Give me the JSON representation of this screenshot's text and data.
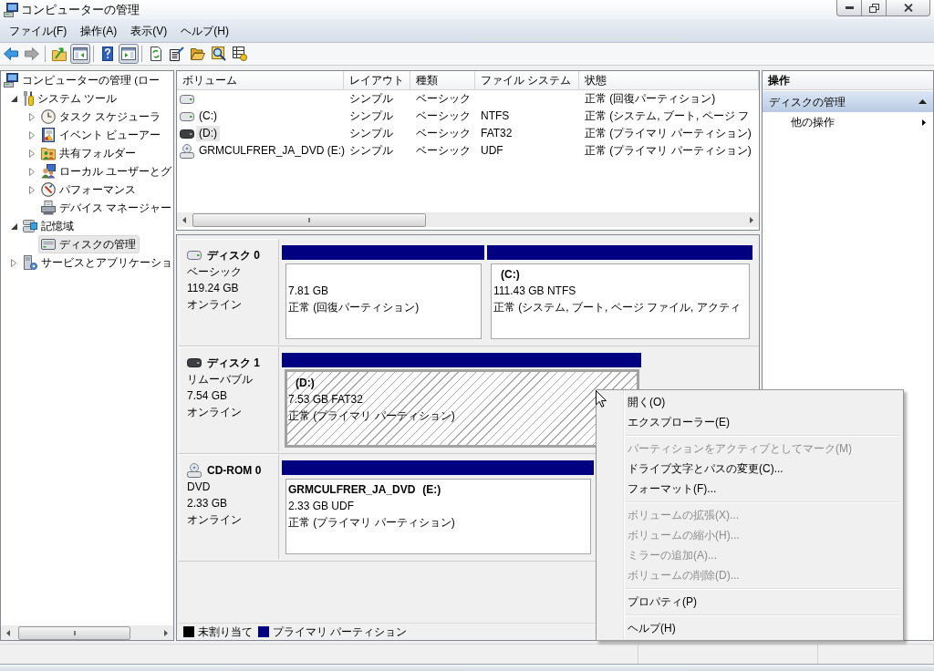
{
  "window": {
    "title": "コンピューターの管理"
  },
  "menu_bar": [
    "ファイル(F)",
    "操作(A)",
    "表示(V)",
    "ヘルプ(H)"
  ],
  "toolbar": {
    "groups": [
      {
        "buttons": [
          {
            "kind": "back",
            "disabled": false,
            "pressed": false
          },
          {
            "kind": "forward",
            "disabled": true,
            "pressed": false
          }
        ]
      },
      {
        "buttons": [
          {
            "kind": "up",
            "disabled": false,
            "pressed": false
          },
          {
            "kind": "tree-toggle",
            "disabled": false,
            "pressed": true
          }
        ]
      },
      {
        "buttons": [
          {
            "kind": "help",
            "disabled": false,
            "pressed": false
          },
          {
            "kind": "action-toggle",
            "disabled": false,
            "pressed": true
          }
        ]
      },
      {
        "buttons": [
          {
            "kind": "refresh",
            "disabled": false,
            "pressed": false
          },
          {
            "kind": "properties",
            "disabled": false,
            "pressed": false
          },
          {
            "kind": "open",
            "disabled": false,
            "pressed": false
          },
          {
            "kind": "search",
            "disabled": false,
            "pressed": false
          },
          {
            "kind": "settings",
            "disabled": false,
            "pressed": false
          }
        ]
      }
    ]
  },
  "tree": {
    "items": [
      {
        "kind": "computer",
        "label": "コンピューターの管理 (ロー",
        "selected": false,
        "children": [
          {
            "kind": "tools",
            "label": "システム ツール",
            "expanded": true,
            "selected": false,
            "children": [
              {
                "kind": "clock",
                "label": "タスク スケジューラ",
                "expanded": false,
                "selected": false
              },
              {
                "kind": "event-log",
                "label": "イベント ビューアー",
                "expanded": false,
                "selected": false
              },
              {
                "kind": "shared-folder",
                "label": "共有フォルダー",
                "expanded": false,
                "selected": false
              },
              {
                "kind": "users",
                "label": "ローカル ユーザーとグ",
                "expanded": false,
                "selected": false
              },
              {
                "kind": "performance",
                "label": "パフォーマンス",
                "expanded": false,
                "selected": false
              },
              {
                "kind": "device",
                "label": "デバイス マネージャー",
                "selected": false
              }
            ]
          },
          {
            "kind": "storage",
            "label": "記憶域",
            "expanded": true,
            "selected": false,
            "children": [
              {
                "kind": "disk",
                "label": "ディスクの管理",
                "selected": true
              }
            ]
          },
          {
            "kind": "services",
            "label": "サービスとアプリケーショ",
            "expanded": false,
            "selected": false
          }
        ]
      }
    ]
  },
  "volume_list": {
    "columns": [
      "ボリューム",
      "レイアウト",
      "種類",
      "ファイル システム",
      "状態"
    ],
    "rows": [
      {
        "kind": "hdd",
        "selected": false,
        "layout": "シンプル",
        "type": "ベーシック",
        "status": "正常 (回復パーティション)"
      },
      {
        "kind": "hdd",
        "selected": false,
        "volume": "(C:)",
        "layout": "シンプル",
        "type": "ベーシック",
        "file_system": "NTFS",
        "status": "正常 (システム, ブート, ページ フ"
      },
      {
        "kind": "removable",
        "selected": true,
        "volume": "(D:)",
        "layout": "シンプル",
        "type": "ベーシック",
        "file_system": "FAT32",
        "status": "正常 (プライマリ パーティション)"
      },
      {
        "kind": "cdrom",
        "selected": false,
        "volume": "GRMCULFRER_JA_DVD (E:)",
        "layout": "シンプル",
        "type": "ベーシック",
        "file_system": "UDF",
        "status": "正常 (プライマリ パーティション)"
      }
    ]
  },
  "disks": [
    {
      "kind": "hdd",
      "name": "ディスク 0",
      "type": "ベーシック",
      "size": "119.24 GB",
      "state": "オンライン",
      "partitions": [
        {
          "selected": false,
          "size": "7.81 GB",
          "status": "正常 (回復パーティション)"
        },
        {
          "selected": false,
          "letter": "(C:)",
          "size": "111.43 GB NTFS",
          "status": "正常 (システム, ブート, ページ ファイル, アクティ"
        }
      ]
    },
    {
      "kind": "removable",
      "name": "ディスク 1",
      "type": "リムーバブル",
      "size": "7.54 GB",
      "state": "オンライン",
      "partitions": [
        {
          "selected": true,
          "letter": "(D:)",
          "size": "7.53 GB FAT32",
          "status": "正常 (プライマリ パーティション)"
        }
      ]
    },
    {
      "kind": "cdrom",
      "name": "CD-ROM 0",
      "type": "DVD",
      "size": "2.33 GB",
      "state": "オンライン",
      "partitions": [
        {
          "selected": false,
          "label": "GRMCULFRER_JA_DVD",
          "letter": "(E:)",
          "size": "2.33 GB UDF",
          "status": "正常 (プライマリ パーティション)"
        }
      ]
    }
  ],
  "legend": [
    {
      "label": "未割り当て",
      "color": "#000000"
    },
    {
      "label": "プライマリ パーティション",
      "color": "#000080"
    }
  ],
  "actions": {
    "title": "操作",
    "sections": [
      {
        "label": "ディスクの管理",
        "expanded": true,
        "items": [
          "他の操作"
        ]
      }
    ]
  },
  "context_menu": [
    {
      "kind": "item",
      "label": "開く(O)",
      "disabled": false
    },
    {
      "kind": "item",
      "label": "エクスプローラー(E)",
      "disabled": false
    },
    {
      "kind": "separator"
    },
    {
      "kind": "item",
      "label": "パーティションをアクティブとしてマーク(M)",
      "disabled": true
    },
    {
      "kind": "item",
      "label": "ドライブ文字とパスの変更(C)...",
      "disabled": false
    },
    {
      "kind": "item",
      "label": "フォーマット(F)...",
      "disabled": false
    },
    {
      "kind": "separator"
    },
    {
      "kind": "item",
      "label": "ボリュームの拡張(X)...",
      "disabled": true
    },
    {
      "kind": "item",
      "label": "ボリュームの縮小(H)...",
      "disabled": true
    },
    {
      "kind": "item",
      "label": "ミラーの追加(A)...",
      "disabled": true
    },
    {
      "kind": "item",
      "label": "ボリュームの削除(D)...",
      "disabled": true
    },
    {
      "kind": "separator"
    },
    {
      "kind": "item",
      "label": "プロパティ(P)",
      "disabled": false
    },
    {
      "kind": "separator"
    },
    {
      "kind": "item",
      "label": "ヘルプ(H)",
      "disabled": false
    }
  ]
}
